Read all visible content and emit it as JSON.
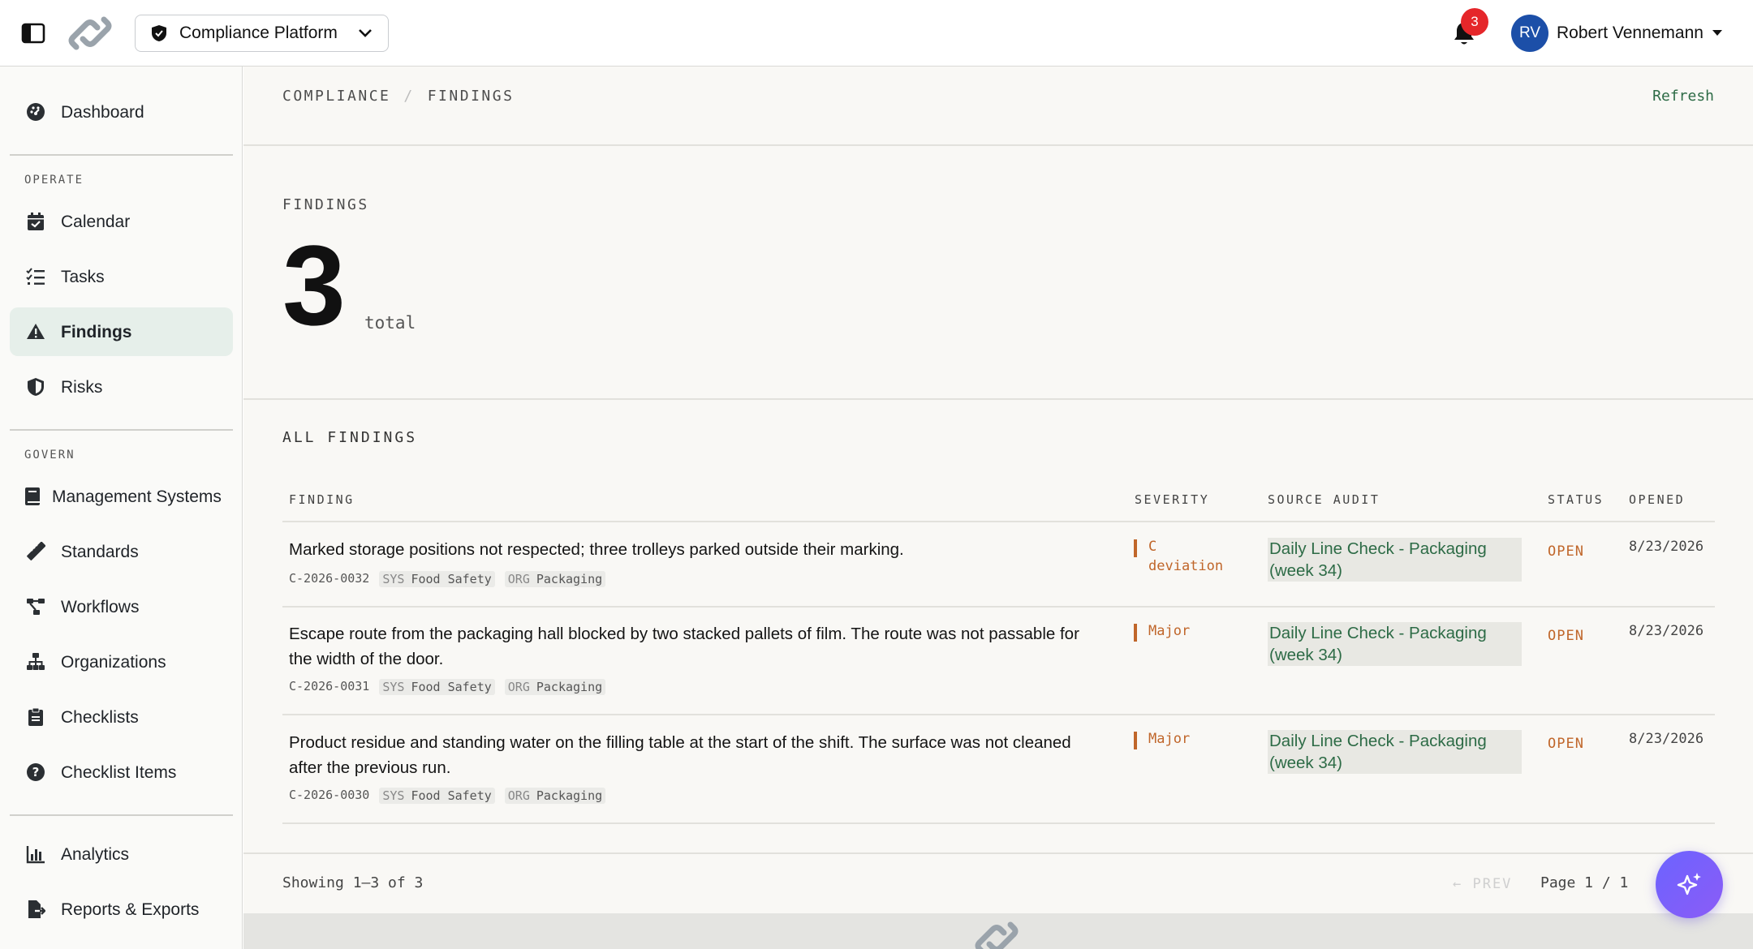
{
  "topbar": {
    "org_switcher_label": "Compliance Platform",
    "notification_count": "3",
    "user_initials": "RV",
    "user_name": "Robert Vennemann"
  },
  "sidebar": {
    "dashboard": "Dashboard",
    "section_operate": "OPERATE",
    "operate_items": [
      "Calendar",
      "Tasks",
      "Findings",
      "Risks"
    ],
    "section_govern": "GOVERN",
    "govern_items": [
      "Management Systems",
      "Standards",
      "Workflows",
      "Organizations",
      "Checklists",
      "Checklist Items"
    ],
    "report_items": [
      "Analytics",
      "Reports & Exports"
    ],
    "active_item": "Findings"
  },
  "main": {
    "breadcrumb": [
      "COMPLIANCE",
      "FINDINGS"
    ],
    "refresh_label": "Refresh",
    "summary_label": "FINDINGS",
    "total_count": "3",
    "total_label": "total",
    "all_label": "ALL FINDINGS",
    "columns": [
      "FINDING",
      "SEVERITY",
      "SOURCE AUDIT",
      "STATUS",
      "OPENED"
    ],
    "rows": [
      {
        "title": "Marked storage positions not respected; three trolleys parked outside their marking.",
        "id": "C-2026-0032",
        "sys_key": "SYS",
        "sys_val": "Food Safety",
        "org_key": "ORG",
        "org_val": "Packaging",
        "severity_line1": "C",
        "severity_line2": "deviation",
        "audit_line1": "Daily Line Check - Packaging",
        "audit_line2": "(week 34)",
        "status": "OPEN",
        "opened": "8/23/2026"
      },
      {
        "title": "Escape route from the packaging hall blocked by two stacked pallets of film. The route was not passable for the width of the door.",
        "id": "C-2026-0031",
        "sys_key": "SYS",
        "sys_val": "Food Safety",
        "org_key": "ORG",
        "org_val": "Packaging",
        "severity_line1": "Major",
        "severity_line2": "",
        "audit_line1": "Daily Line Check - Packaging",
        "audit_line2": "(week 34)",
        "status": "OPEN",
        "opened": "8/23/2026"
      },
      {
        "title": "Product residue and standing water on the filling table at the start of the shift. The surface was not cleaned after the previous run.",
        "id": "C-2026-0030",
        "sys_key": "SYS",
        "sys_val": "Food Safety",
        "org_key": "ORG",
        "org_val": "Packaging",
        "severity_line1": "Major",
        "severity_line2": "",
        "audit_line1": "Daily Line Check - Packaging",
        "audit_line2": "(week 34)",
        "status": "OPEN",
        "opened": "8/23/2026"
      }
    ],
    "pagination": {
      "showing": "Showing 1–3 of 3",
      "prev_label": "← PREV",
      "page_info": "Page 1 / 1"
    }
  },
  "colors": {
    "accent_green": "#2d6b46",
    "severity_orange": "#c0662a",
    "badge_red": "#e5262a",
    "avatar_blue": "#1c4fa8",
    "fab_purple": "#7c5cf6"
  }
}
